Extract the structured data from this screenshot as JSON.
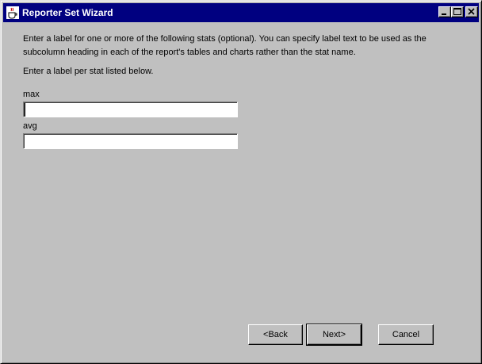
{
  "window": {
    "title": "Reporter Set Wizard",
    "icons": {
      "app": "java-coffee-cup-icon",
      "minimize": "minimize-icon",
      "maximize": "maximize-icon",
      "close": "close-icon"
    },
    "colors": {
      "titlebar": "#000080",
      "face": "#c0c0c0"
    }
  },
  "content": {
    "instruction_line1": "Enter a label for one or more of the following stats (optional).  You can specify label text to be used as the",
    "instruction_line2": "subcolumn heading in each of the report's tables and charts rather than the stat name.",
    "instruction_line3": "Enter a label per stat listed below.",
    "fields": [
      {
        "label": "max",
        "value": ""
      },
      {
        "label": "avg",
        "value": ""
      }
    ]
  },
  "buttons": {
    "back": "<Back",
    "next": "Next>",
    "cancel": "Cancel"
  }
}
